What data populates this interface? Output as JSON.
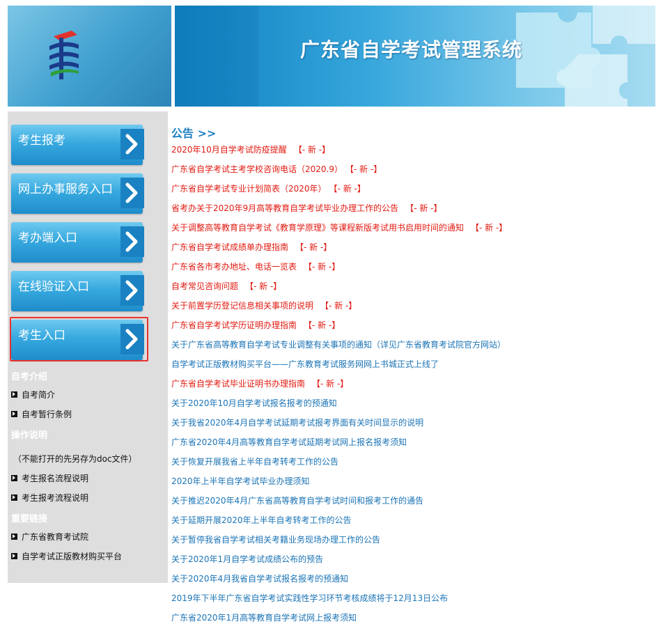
{
  "header": {
    "title": "广东省自学考试管理系统"
  },
  "sidebar": {
    "nav_buttons": [
      {
        "label": "考生报考"
      },
      {
        "label": "网上办事服务入口"
      },
      {
        "label": "考办端入口"
      },
      {
        "label": "在线验证入口"
      },
      {
        "label": "考生入口",
        "highlighted": true
      }
    ],
    "sections": {
      "intro": {
        "heading": "自考介绍",
        "links": [
          "自考简介",
          "自考暂行条例"
        ]
      },
      "ops": {
        "heading": "操作说明",
        "note": "（不能打开的先另存为doc文件）",
        "links": [
          "考生报名流程说明",
          "考生报考流程说明"
        ]
      },
      "links": {
        "heading": "重要链接",
        "links": [
          "广东省教育考试院",
          "自学考试正版教材购买平台"
        ]
      }
    }
  },
  "notices": {
    "heading": "公告 >>",
    "new_tag": "【- 新 -】",
    "items": [
      {
        "text": "2020年10月自学考试防疫提醒",
        "is_new": true
      },
      {
        "text": "广东省自学考试主考学校咨询电话（2020.9）",
        "is_new": true
      },
      {
        "text": "广东省自学考试专业计划简表（2020年）",
        "is_new": true
      },
      {
        "text": "省考办关于2020年9月高等教育自学考试毕业办理工作的公告",
        "is_new": true
      },
      {
        "text": "关于调整高等教育自学考试《教育学原理》等课程新版考试用书启用时间的通知",
        "is_new": true
      },
      {
        "text": "广东省自学考试成绩单办理指南",
        "is_new": true
      },
      {
        "text": "广东省各市考办地址、电话一览表",
        "is_new": true
      },
      {
        "text": "自考常见咨询问题",
        "is_new": true
      },
      {
        "text": "关于前置学历登记信息相关事项的说明",
        "is_new": true
      },
      {
        "text": "广东省自学考试学历证明办理指南",
        "is_new": true
      },
      {
        "text": "关于广东省高等教育自学考试专业调整有关事项的通知（详见广东省教育考试院官方网站）",
        "is_new": false
      },
      {
        "text": "自学考试正版教材购买平台——广东教育考试服务网网上书城正式上线了",
        "is_new": false
      },
      {
        "text": "广东省自学考试毕业证明书办理指南",
        "is_new": true
      },
      {
        "text": "关于2020年10月自学考试报名报考的预通知",
        "is_new": false
      },
      {
        "text": "关于我省2020年4月自学考试延期考试报考界面有关时间显示的说明",
        "is_new": false
      },
      {
        "text": "广东省2020年4月高等教育自学考试延期考试网上报名报考须知",
        "is_new": false
      },
      {
        "text": "关于恢复开展我省上半年自考转考工作的公告",
        "is_new": false
      },
      {
        "text": "2020年上半年自学考试毕业办理须知",
        "is_new": false
      },
      {
        "text": "关于推迟2020年4月广东省高等教育自学考试时间和报考工作的通告",
        "is_new": false
      },
      {
        "text": "关于延期开展2020年上半年自考转考工作的公告",
        "is_new": false
      },
      {
        "text": "关于暂停我省自学考试相关考籍业务现场办理工作的公告",
        "is_new": false
      },
      {
        "text": "关于2020年1月自学考试成绩公布的预告",
        "is_new": false
      },
      {
        "text": "关于2020年4月我省自学考试报名报考的预通知",
        "is_new": false
      },
      {
        "text": "2019年下半年广东省自学考试实践性学习环节考核成绩将于12月13日公布",
        "is_new": false
      },
      {
        "text": "广东省2020年1月高等教育自学考试网上报考须知",
        "is_new": false
      }
    ]
  }
}
